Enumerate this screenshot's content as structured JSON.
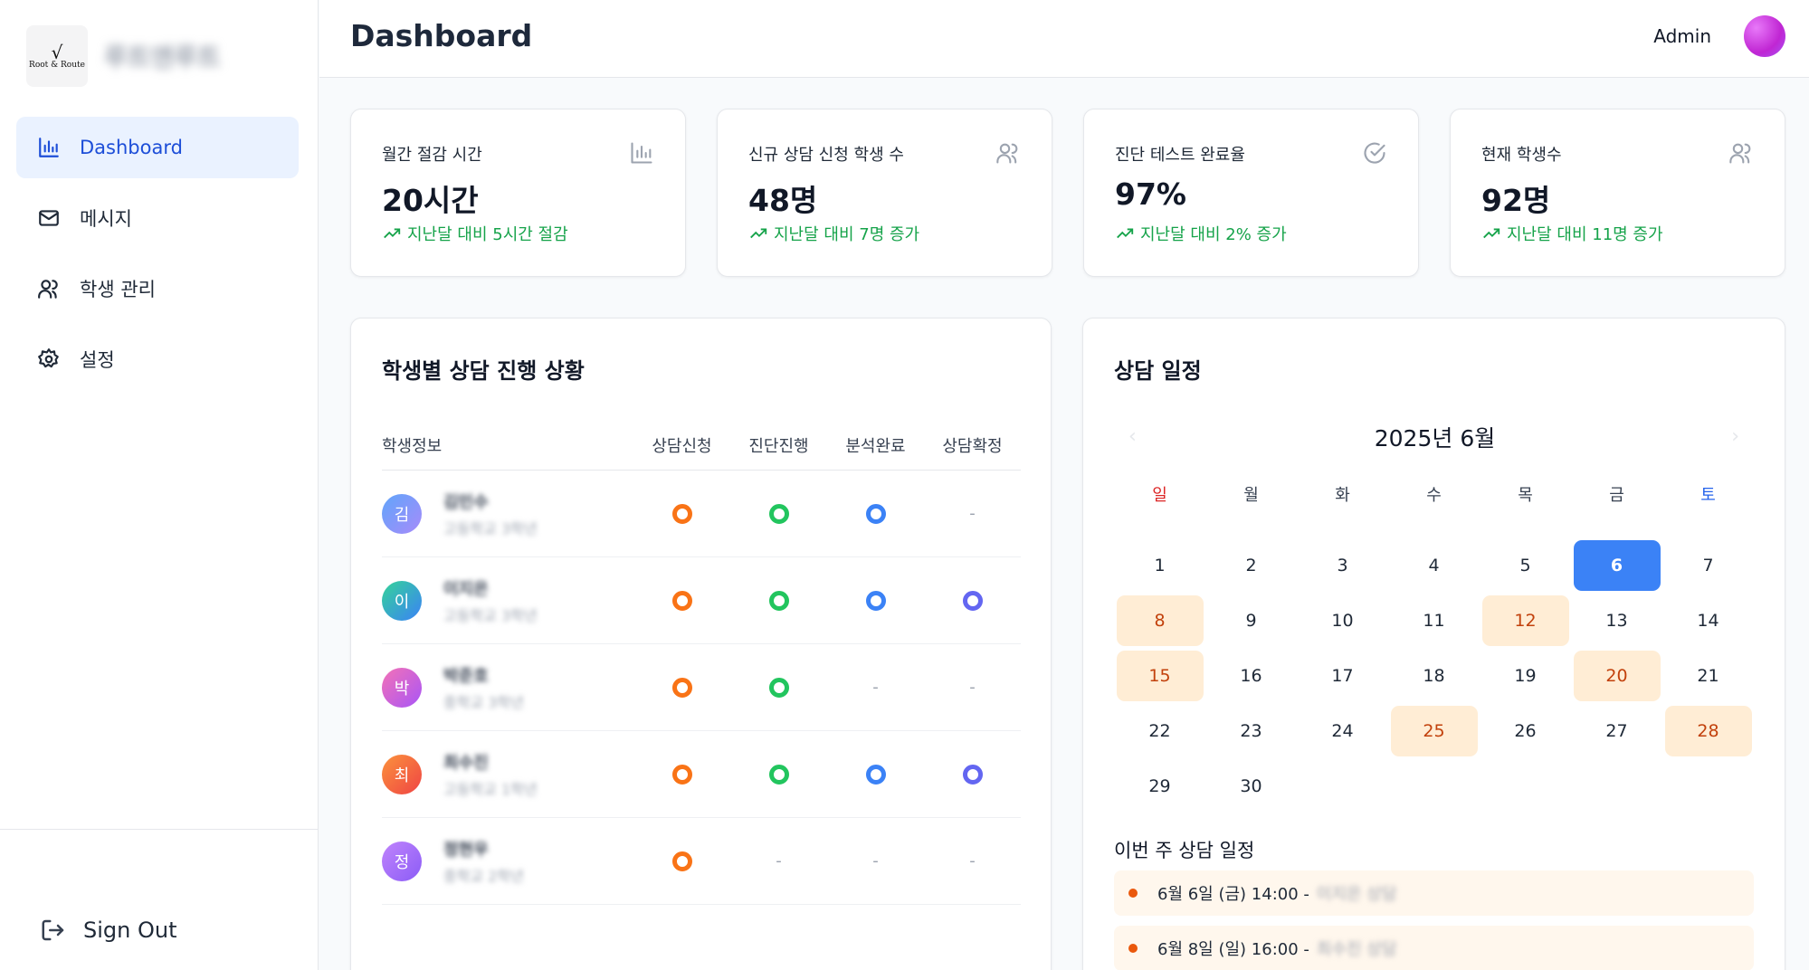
{
  "sidebar": {
    "logo_symbol": "√",
    "logo_text": "Root & Route",
    "brand_name": "루트앤루트",
    "items": [
      {
        "label": "Dashboard",
        "icon": "bar-chart-icon"
      },
      {
        "label": "메시지",
        "icon": "mail-icon"
      },
      {
        "label": "학생 관리",
        "icon": "users-icon"
      },
      {
        "label": "설정",
        "icon": "gear-icon"
      }
    ],
    "sign_out": "Sign Out"
  },
  "header": {
    "title": "Dashboard",
    "user": "Admin"
  },
  "stats": [
    {
      "label": "월간 절감 시간",
      "value": "20시간",
      "trend": "지난달 대비 5시간 절감",
      "icon": "bar-chart-icon"
    },
    {
      "label": "신규 상담 신청 학생 수",
      "value": "48명",
      "trend": "지난달 대비 7명 증가",
      "icon": "users-icon"
    },
    {
      "label": "진단 테스트 완료율",
      "value": "97%",
      "trend": "지난달 대비 2% 증가",
      "icon": "check-circle-icon"
    },
    {
      "label": "현재 학생수",
      "value": "92명",
      "trend": "지난달 대비 11명 증가",
      "icon": "users-icon"
    }
  ],
  "progress": {
    "title": "학생별 상담 진행 상황",
    "columns": [
      "학생정보",
      "상담신청",
      "진단진행",
      "분석완료",
      "상담확정"
    ],
    "dash": "-",
    "rows": [
      {
        "initial": "김",
        "name": "김민수",
        "grade": "고등학교 3학년",
        "status": [
          true,
          true,
          true,
          false
        ]
      },
      {
        "initial": "이",
        "name": "이지은",
        "grade": "고등학교 3학년",
        "status": [
          true,
          true,
          true,
          true
        ]
      },
      {
        "initial": "박",
        "name": "박준호",
        "grade": "중학교 3학년",
        "status": [
          true,
          true,
          false,
          false
        ]
      },
      {
        "initial": "최",
        "name": "최수진",
        "grade": "고등학교 1학년",
        "status": [
          true,
          true,
          true,
          true
        ]
      },
      {
        "initial": "정",
        "name": "정현우",
        "grade": "중학교 2학년",
        "status": [
          true,
          false,
          false,
          false
        ]
      }
    ]
  },
  "calendar": {
    "title": "상담 일정",
    "month_label": "2025년 6월",
    "prev": "‹",
    "next": "›",
    "weekdays": [
      "일",
      "월",
      "화",
      "수",
      "목",
      "금",
      "토"
    ],
    "today": 6,
    "highlighted": [
      8,
      12,
      15,
      20,
      25,
      28
    ],
    "weeks": [
      [
        "1",
        "2",
        "3",
        "4",
        "5",
        "6",
        "7"
      ],
      [
        "8",
        "9",
        "10",
        "11",
        "12",
        "13",
        "14"
      ],
      [
        "15",
        "16",
        "17",
        "18",
        "19",
        "20",
        "21"
      ],
      [
        "22",
        "23",
        "24",
        "25",
        "26",
        "27",
        "28"
      ],
      [
        "29",
        "30",
        "",
        "",
        "",
        "",
        ""
      ]
    ],
    "week_title": "이번 주 상담 일정",
    "schedule": [
      {
        "time": "6월 6일 (금) 14:00 -",
        "detail": "이지은 상담"
      },
      {
        "time": "6월 8일 (일) 16:00 -",
        "detail": "최수진 상담"
      }
    ]
  },
  "colors": {
    "accent": "#3b82f6",
    "trend_green": "#16a34a",
    "ring_apply": "#f97316",
    "ring_diagnose": "#22c55e",
    "ring_analysis": "#3b82f6",
    "ring_confirm": "#6366f1",
    "highlight_bg": "#ffedd5"
  }
}
